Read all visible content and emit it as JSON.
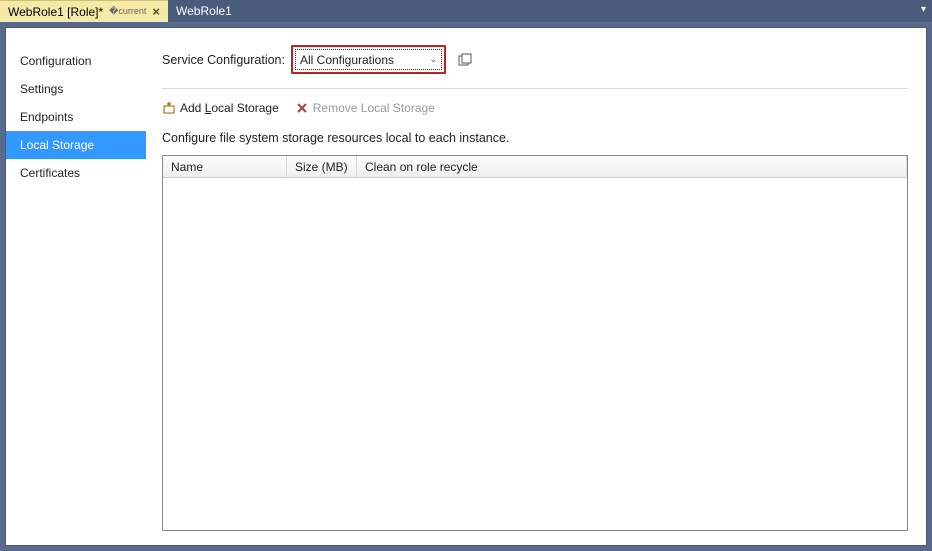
{
  "tabs": [
    {
      "label": "WebRole1 [Role]*",
      "active": true
    },
    {
      "label": "WebRole1",
      "active": false
    }
  ],
  "sidebar": {
    "items": [
      {
        "label": "Configuration"
      },
      {
        "label": "Settings"
      },
      {
        "label": "Endpoints"
      },
      {
        "label": "Local Storage"
      },
      {
        "label": "Certificates"
      }
    ],
    "selected_index": 3
  },
  "service_config": {
    "label": "Service Configuration:",
    "value": "All Configurations"
  },
  "toolbar": {
    "add_label_pre": "Add ",
    "add_label_key": "L",
    "add_label_post": "ocal Storage",
    "remove_label": "Remove Local Storage"
  },
  "description": "Configure file system storage resources local to each instance.",
  "grid": {
    "columns": [
      "Name",
      "Size (MB)",
      "Clean on role recycle"
    ]
  }
}
